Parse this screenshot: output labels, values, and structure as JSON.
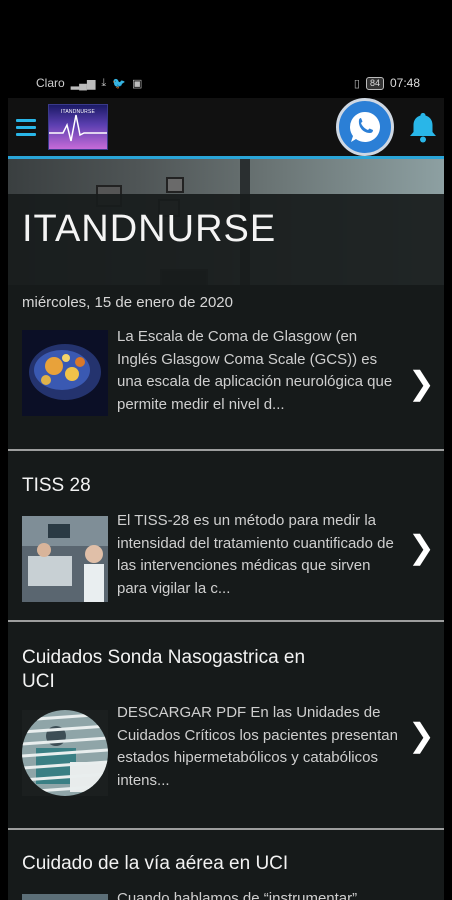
{
  "status_bar": {
    "carrier": "Claro",
    "battery": "84",
    "time": "07:48"
  },
  "header": {
    "logo_text": "ITANDNURSE"
  },
  "blog": {
    "title": "ITANDNURSE",
    "date": "miércoles, 15 de enero de 2020"
  },
  "posts": [
    {
      "title": "",
      "excerpt": "La  Escala de Coma de Glasgow (en Inglés Glasgow Coma Scale (GCS)) es una escala de aplicación neurológica que permite medir el nivel d..."
    },
    {
      "title": "TISS 28",
      "excerpt": "El TISS-28 es un método para medir la intensidad del tratamiento cuantificado de las intervenciones médicas que sirven para vigilar la c..."
    },
    {
      "title": "Cuidados Sonda Nasogastrica en UCI",
      "excerpt": "DESCARGAR PDF En  las  Unidades de  Cuidados  Críticos  los pacientes  presentan  estados hipermetabólicos  y  catabólicos intens..."
    },
    {
      "title": "Cuidado de la vía aérea en UCI",
      "excerpt": "Cuando hablamos de “instrumentar”"
    }
  ],
  "icons": {
    "menu": "hamburger-menu-icon",
    "whatsapp": "whatsapp-icon",
    "bell": "bell-icon",
    "chevron": "chevron-right-icon"
  },
  "colors": {
    "accent": "#2aa5d8",
    "whatsapp": "#2b7fd6",
    "bell": "#29b6e8"
  }
}
